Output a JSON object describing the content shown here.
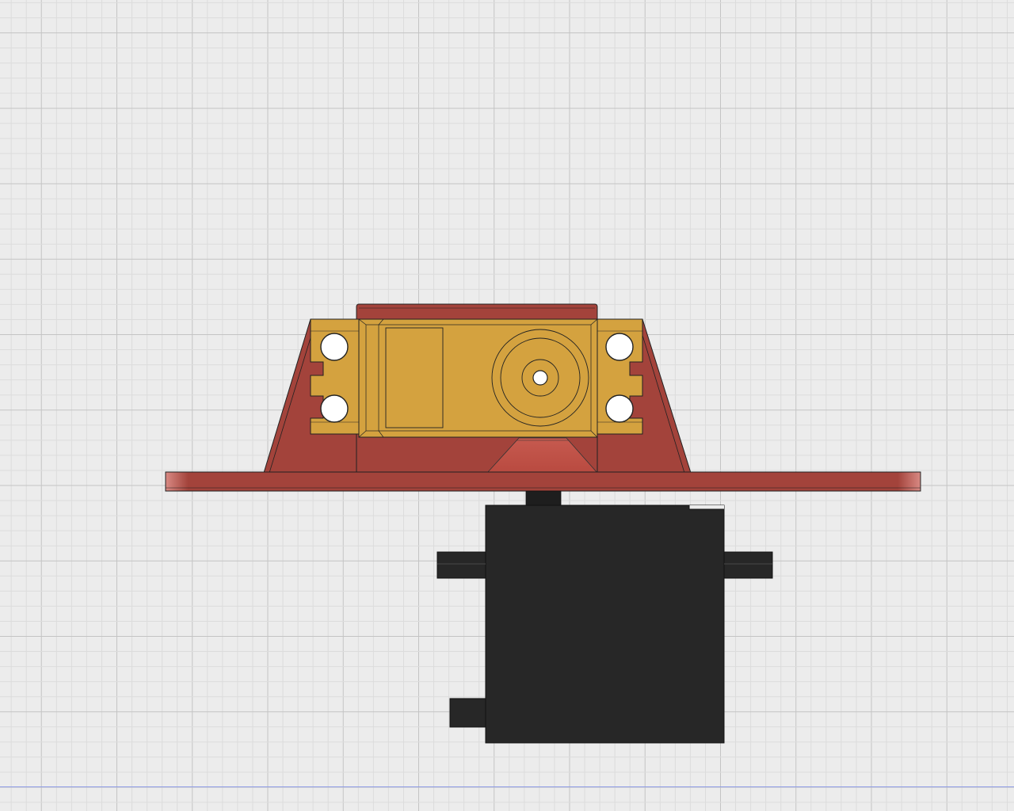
{
  "viewport": {
    "background_color": "#ececec",
    "grid": {
      "visible": true,
      "minor_color": "#dcdcdc",
      "major_color": "#c4c4c4",
      "axis_color": "#8d9be6"
    }
  },
  "model": {
    "components": [
      {
        "name": "servo-mount-bracket",
        "color": "#a3433b"
      },
      {
        "name": "bracket-base-plate",
        "color": "#a3433b"
      },
      {
        "name": "servo-mounting-flange",
        "color": "#d4a23f"
      },
      {
        "name": "servo-output-spline",
        "color": "#d4a23f"
      },
      {
        "name": "servo-body",
        "color": "#272727"
      }
    ],
    "edge_color": "#222222"
  }
}
